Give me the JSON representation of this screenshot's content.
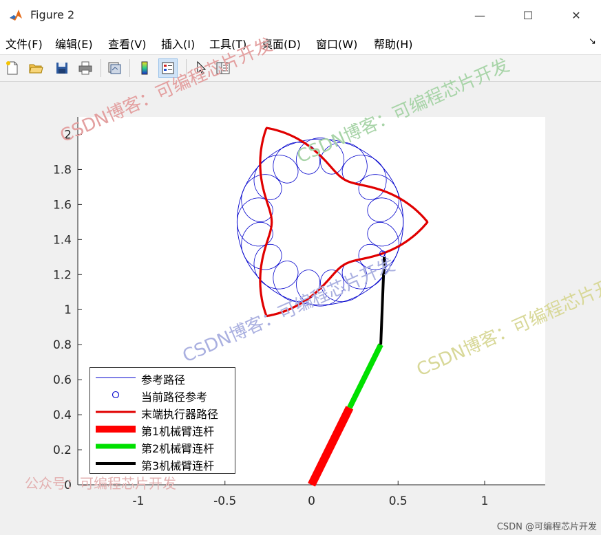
{
  "window": {
    "title": "Figure 2",
    "minimize_glyph": "—",
    "maximize_glyph": "☐",
    "close_glyph": "✕"
  },
  "menu": {
    "items": [
      "文件(F)",
      "编辑(E)",
      "查看(V)",
      "插入(I)",
      "工具(T)",
      "桌面(D)",
      "窗口(W)",
      "帮助(H)"
    ],
    "dock_glyph": "↘"
  },
  "toolbar": {
    "buttons": [
      "new-figure-icon",
      "open-file-icon",
      "save-icon",
      "print-icon",
      "link-plot-icon",
      "insert-colorbar-icon",
      "insert-legend-icon",
      "edit-plot-icon",
      "property-inspector-icon"
    ]
  },
  "chart_data": {
    "type": "line",
    "xlim": [
      -1.35,
      1.35
    ],
    "ylim": [
      0,
      2.1
    ],
    "x_ticks": [
      "-1",
      "-0.5",
      "0",
      "0.5",
      "1"
    ],
    "x_tick_values": [
      -1,
      -0.5,
      0,
      0.5,
      1
    ],
    "y_ticks": [
      "0",
      "0.2",
      "0.4",
      "0.6",
      "0.8",
      "1",
      "1.2",
      "1.4",
      "1.6",
      "1.8",
      "2"
    ],
    "y_tick_values": [
      0,
      0.2,
      0.4,
      0.6,
      0.8,
      1,
      1.2,
      1.4,
      1.6,
      1.8,
      2
    ],
    "grid": false,
    "legend_position": "bottom-left",
    "reference_path": {
      "center": [
        0.05,
        1.5
      ],
      "radius": 0.48,
      "inner_radius": 0.1,
      "loops": 16,
      "color": "#0000cc"
    },
    "current_reference_point": [
      0.41,
      1.32
    ],
    "end_effector_path": {
      "center": [
        0.05,
        1.5
      ],
      "radius": 0.45,
      "lobe_amplitude": 0.17,
      "lobes": 3,
      "color": "#e00000"
    },
    "links": [
      {
        "name": "第1机械臂连杆",
        "from": [
          0,
          0
        ],
        "to": [
          0.22,
          0.44
        ],
        "color": "#ff0000"
      },
      {
        "name": "第2机械臂连杆",
        "from": [
          0.22,
          0.44
        ],
        "to": [
          0.4,
          0.8
        ],
        "color": "#00e000"
      },
      {
        "name": "第3机械臂连杆",
        "from": [
          0.4,
          0.8
        ],
        "to": [
          0.42,
          1.3
        ],
        "color": "#000000"
      }
    ],
    "legend": [
      {
        "label": "参考路径",
        "kind": "thin-line",
        "color": "#0000cc"
      },
      {
        "label": "当前路径参考",
        "kind": "circle-marker",
        "color": "#0000cc"
      },
      {
        "label": "末端执行器路径",
        "kind": "medium-line",
        "color": "#e00000"
      },
      {
        "label": "第1机械臂连杆",
        "kind": "thick-line",
        "color": "#ff0000"
      },
      {
        "label": "第2机械臂连杆",
        "kind": "thick-line",
        "color": "#00e000"
      },
      {
        "label": "第3机械臂连杆",
        "kind": "thick-line",
        "color": "#000000"
      }
    ]
  },
  "watermarks": [
    {
      "text": "CSDN博客：可编程芯片开发",
      "color": "#e3a0a0"
    },
    {
      "text": "CSDN博客：可编程芯片开发",
      "color": "#a8d4a8"
    },
    {
      "text": "CSDN博客：可编程芯片开发",
      "color": "#aab0e0"
    },
    {
      "text": "CSDN博客：可编程芯片开发",
      "color": "#d8d898"
    },
    {
      "text": "公众号：可编程芯片开发",
      "color": "#e3b0b0"
    }
  ],
  "footer_credit": "CSDN @可编程芯片开发"
}
